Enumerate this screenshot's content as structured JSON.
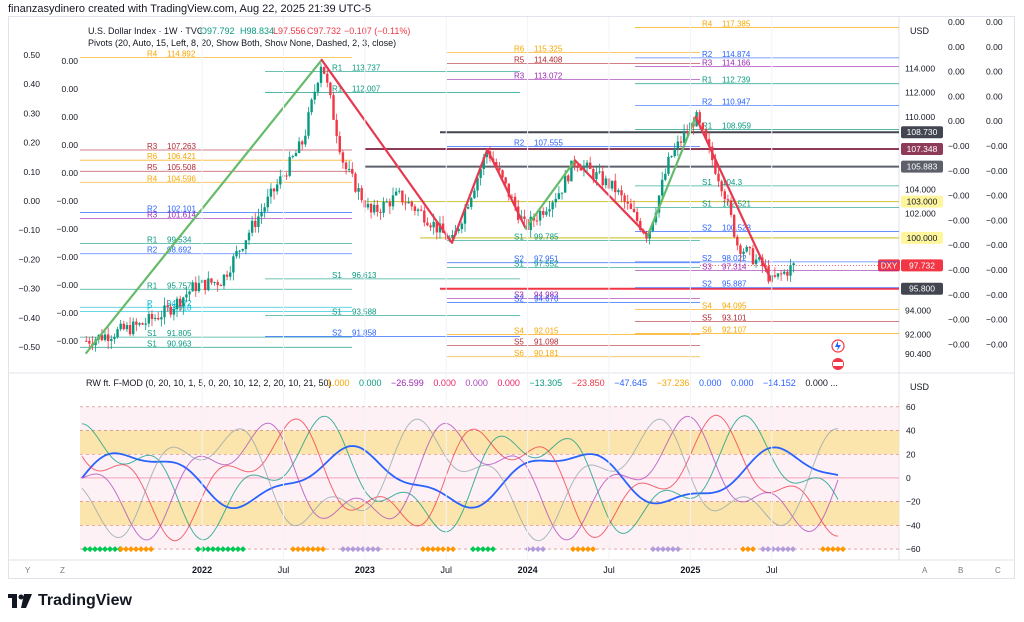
{
  "header": {
    "credit": "finanzasydinero created with TradingView.com, Aug 22, 2025 21:39 UTC-5"
  },
  "main_pane": {
    "title": "U.S. Dollar Index · 1W · TVC",
    "ohlc": {
      "o": "O97.792",
      "h": "H98.834",
      "l": "L97.556",
      "c": "C97.732",
      "chg": "−0.107 (−0.11%)"
    },
    "pivots_label": "Pivots (20, Auto, 15, Left, 8, 20, Show Both, Show None, Dashed, 2, 3, close)",
    "currency": "USD",
    "price_ticks": [
      "114.000",
      "112.000",
      "110.000",
      "104.000",
      "102.000",
      "94.000",
      "92.000",
      "90.400"
    ],
    "price_badges": [
      {
        "text": "108.730",
        "color": "#434651"
      },
      {
        "text": "107.348",
        "color": "#8e3b5a"
      },
      {
        "text": "105.883",
        "color": "#5d606b"
      },
      {
        "text": "103.000",
        "color": "#fff59d"
      },
      {
        "text": "100.000",
        "color": "#fff59d"
      },
      {
        "text": "97.732",
        "color": "#f23645"
      },
      {
        "text": "95.800",
        "color": "#434651"
      }
    ],
    "symbol_badge": "DXY",
    "left_axis": [
      "0.50",
      "0.40",
      "0.30",
      "0.20",
      "0.10",
      "0.00",
      "−0.10",
      "−0.20",
      "−0.30",
      "−0.40",
      "−0.50"
    ],
    "mid_axis": [
      "0.00",
      "0.00",
      "0.00",
      "0.00",
      "0.00",
      "−0.00",
      "−0.00",
      "−0.00",
      "−0.00",
      "−0.00",
      "−0.00"
    ],
    "far_axis_1": [
      "0.00",
      "0.00",
      "0.00",
      "0.00",
      "0.00",
      "−0.00",
      "−0.00",
      "−0.00",
      "−0.00",
      "−0.00",
      "−0.00",
      "−0.00",
      "−0.00",
      "−0.00"
    ],
    "far_axis_2": [
      "0.00",
      "0.00",
      "0.00",
      "0.00",
      "0.00",
      "−0.00",
      "−0.00",
      "−0.00",
      "−0.00",
      "−0.00",
      "−0.00",
      "−0.00",
      "−0.00",
      "−0.00"
    ]
  },
  "pivot_levels": [
    {
      "label": "R4",
      "value": "114.892",
      "color": "#f7a600"
    },
    {
      "label": "R3",
      "value": "107.263",
      "color": "#b22833"
    },
    {
      "label": "R6",
      "value": "106.421",
      "color": "#f7a600"
    },
    {
      "label": "R5",
      "value": "105.508",
      "color": "#b22833"
    },
    {
      "label": "R4",
      "value": "104.596",
      "color": "#f7a600"
    },
    {
      "label": "R2",
      "value": "102.101",
      "color": "#2962ff"
    },
    {
      "label": "R3",
      "value": "101.614",
      "color": "#9c27b0"
    },
    {
      "label": "R1",
      "value": "99.534",
      "color": "#089981"
    },
    {
      "label": "R2",
      "value": "98.692",
      "color": "#2962ff"
    },
    {
      "label": "R1",
      "value": "95.757",
      "color": "#089981"
    },
    {
      "label": "P",
      "value": "94.272",
      "color": "#00bcd4"
    },
    {
      "label": "P",
      "value": "93.918",
      "color": "#00bcd4"
    },
    {
      "label": "S1",
      "value": "91.805",
      "color": "#089981"
    },
    {
      "label": "S1",
      "value": "90.963",
      "color": "#089981"
    },
    {
      "label": "R1",
      "value": "113.737",
      "color": "#089981"
    },
    {
      "label": "R1",
      "value": "112.007",
      "color": "#089981"
    },
    {
      "label": "S1",
      "value": "96.613",
      "color": "#089981"
    },
    {
      "label": "S1",
      "value": "93.588",
      "color": "#089981"
    },
    {
      "label": "S2",
      "value": "91.858",
      "color": "#2962ff"
    },
    {
      "label": "R6",
      "value": "115.325",
      "color": "#f7a600"
    },
    {
      "label": "R5",
      "value": "114.408",
      "color": "#b22833"
    },
    {
      "label": "R3",
      "value": "113.072",
      "color": "#9c27b0"
    },
    {
      "label": "R2",
      "value": "107.555",
      "color": "#2962ff"
    },
    {
      "label": "S1",
      "value": "99.785",
      "color": "#089981"
    },
    {
      "label": "S2",
      "value": "97.951",
      "color": "#2962ff"
    },
    {
      "label": "S1",
      "value": "97.552",
      "color": "#089981"
    },
    {
      "label": "S3",
      "value": "94.983",
      "color": "#9c27b0"
    },
    {
      "label": "S2",
      "value": "94.670",
      "color": "#2962ff"
    },
    {
      "label": "S4",
      "value": "92.015",
      "color": "#f7a600"
    },
    {
      "label": "S5",
      "value": "91.098",
      "color": "#b22833"
    },
    {
      "label": "S6",
      "value": "90.181",
      "color": "#f7a600"
    },
    {
      "label": "R4",
      "value": "117.385",
      "color": "#f7a600"
    },
    {
      "label": "R2",
      "value": "114.874",
      "color": "#2962ff"
    },
    {
      "label": "R3",
      "value": "114.166",
      "color": "#9c27b0"
    },
    {
      "label": "R1",
      "value": "112.739",
      "color": "#089981"
    },
    {
      "label": "R2",
      "value": "110.947",
      "color": "#2962ff"
    },
    {
      "label": "R1",
      "value": "108.959",
      "color": "#089981"
    },
    {
      "label": "S1",
      "value": "104.3",
      "color": "#089981"
    },
    {
      "label": "S1",
      "value": "102.521",
      "color": "#089981"
    },
    {
      "label": "S2",
      "value": "100.523",
      "color": "#2962ff"
    },
    {
      "label": "S2",
      "value": "98.022",
      "color": "#2962ff"
    },
    {
      "label": "S3",
      "value": "97.314",
      "color": "#9c27b0"
    },
    {
      "label": "S2",
      "value": "95.887",
      "color": "#2962ff"
    },
    {
      "label": "S4",
      "value": "94.095",
      "color": "#f7a600"
    },
    {
      "label": "S5",
      "value": "93.101",
      "color": "#b22833"
    },
    {
      "label": "S6",
      "value": "92.107",
      "color": "#f7a600"
    }
  ],
  "osc_pane": {
    "title": "RW ft. F-MOD (0, 20, 10, 1, 5, 0, 20, 10, 12, 2, 20, 10, 21, 50)",
    "values": [
      {
        "text": "1.000",
        "color": "#f7a600"
      },
      {
        "text": "0.000",
        "color": "#089981"
      },
      {
        "text": "−26.599",
        "color": "#9c27b0"
      },
      {
        "text": "0.000",
        "color": "#e91e63"
      },
      {
        "text": "0.000",
        "color": "#ab47bc"
      },
      {
        "text": "0.000",
        "color": "#e91e63"
      },
      {
        "text": "−13.305",
        "color": "#089981"
      },
      {
        "text": "−23.850",
        "color": "#f23645"
      },
      {
        "text": "−47.645",
        "color": "#2962ff"
      },
      {
        "text": "−37.236",
        "color": "#f7a600"
      },
      {
        "text": "0.000",
        "color": "#2962ff"
      },
      {
        "text": "0.000",
        "color": "#2962ff"
      },
      {
        "text": "−14.152",
        "color": "#2962ff"
      },
      {
        "text": "0.000 ...",
        "color": "#131722"
      }
    ],
    "currency": "USD",
    "ticks": [
      "60",
      "40",
      "20",
      "0",
      "−20",
      "−40",
      "−60"
    ]
  },
  "time_axis": {
    "labels": [
      "2022",
      "Jul",
      "2023",
      "Jul",
      "2024",
      "Jul",
      "2025",
      "Jul"
    ]
  },
  "corner_labels": {
    "y": "Y",
    "z": "Z",
    "a": "A",
    "b": "B",
    "c": "C"
  },
  "brand": {
    "name": "TradingView"
  },
  "chart_data": {
    "type": "candlestick",
    "title": "U.S. Dollar Index · 1W · TVC",
    "x_range": [
      "2021",
      "2025-08"
    ],
    "ylim": [
      89.5,
      118
    ],
    "series": [
      {
        "name": "DXY",
        "values": [
          [
            "2021-04",
            91.5
          ],
          [
            "2021-08",
            92.8
          ],
          [
            "2021-10",
            94.0
          ],
          [
            "2021-12",
            96.0
          ],
          [
            "2022-02",
            96.5
          ],
          [
            "2022-04",
            100.5
          ],
          [
            "2022-06",
            104.2
          ],
          [
            "2022-08",
            108.0
          ],
          [
            "2022-09-26",
            114.7
          ],
          [
            "2022-11",
            106.0
          ],
          [
            "2023-01",
            102.0
          ],
          [
            "2023-03",
            103.5
          ],
          [
            "2023-05",
            101.8
          ],
          [
            "2023-07-14",
            99.6
          ],
          [
            "2023-09",
            105.5
          ],
          [
            "2023-10-02",
            107.3
          ],
          [
            "2023-12-27",
            100.8
          ],
          [
            "2024-03",
            104.0
          ],
          [
            "2024-04-16",
            106.4
          ],
          [
            "2024-07",
            104.0
          ],
          [
            "2024-09-27",
            100.2
          ],
          [
            "2024-11",
            106.5
          ],
          [
            "2025-01-13",
            110.0
          ],
          [
            "2025-03",
            104.0
          ],
          [
            "2025-04",
            99.5
          ],
          [
            "2025-06",
            97.5
          ],
          [
            "2025-07-01",
            96.4
          ],
          [
            "2025-08-22",
            97.732
          ]
        ]
      }
    ],
    "horizontal_levels": [
      108.73,
      107.348,
      105.883,
      103.0,
      100.0,
      95.8
    ],
    "trend_segments": [
      {
        "from": [
          "2021-04",
          90.5
        ],
        "to": [
          "2022-09-26",
          114.7
        ],
        "color": "#66bb6a"
      },
      {
        "from": [
          "2022-09-26",
          114.7
        ],
        "to": [
          "2023-07-14",
          99.6
        ],
        "color": "#e53950"
      },
      {
        "from": [
          "2023-07-14",
          99.6
        ],
        "to": [
          "2023-10-02",
          107.3
        ],
        "color": "#e53950"
      },
      {
        "from": [
          "2023-10-02",
          107.3
        ],
        "to": [
          "2023-12-27",
          100.8
        ],
        "color": "#e53950"
      },
      {
        "from": [
          "2023-12-27",
          100.8
        ],
        "to": [
          "2024-04-16",
          106.4
        ],
        "color": "#66bb6a"
      },
      {
        "from": [
          "2024-04-16",
          106.4
        ],
        "to": [
          "2024-09-27",
          100.2
        ],
        "color": "#e53950"
      },
      {
        "from": [
          "2024-09-27",
          100.2
        ],
        "to": [
          "2025-01-13",
          110.0
        ],
        "color": "#66bb6a"
      },
      {
        "from": [
          "2025-01-13",
          110.0
        ],
        "to": [
          "2025-07-01",
          96.4
        ],
        "color": "#e53950"
      }
    ],
    "oscillator": {
      "ylim": [
        -65,
        70
      ],
      "bands": [
        [
          20,
          40
        ],
        [
          -40,
          -20
        ]
      ]
    }
  }
}
